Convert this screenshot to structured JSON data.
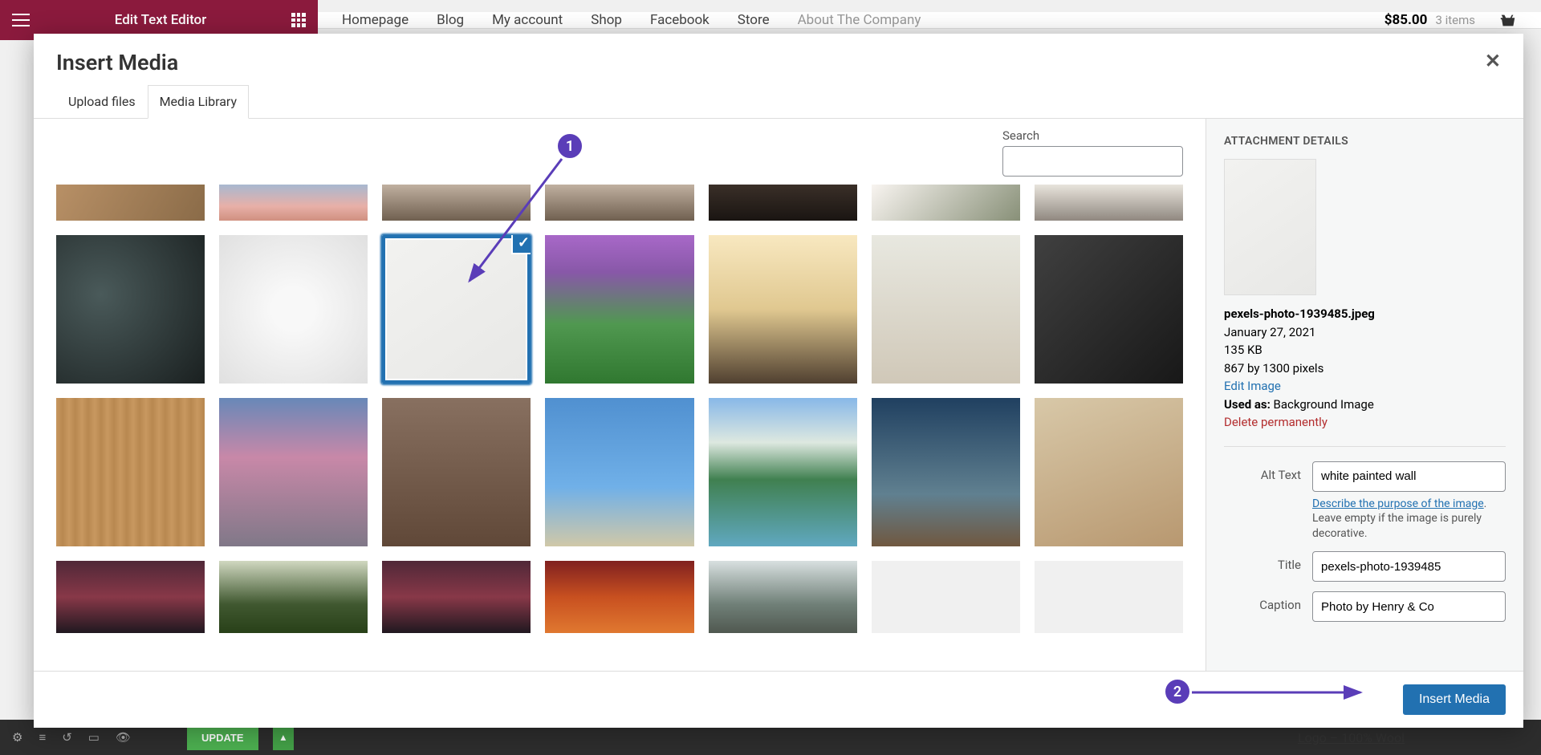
{
  "header": {
    "edit_label": "Edit Text Editor",
    "nav": [
      "Homepage",
      "Blog",
      "My account",
      "Shop",
      "Facebook",
      "Store",
      "About The Company"
    ],
    "cart_price": "$85.00",
    "cart_count": "3 items"
  },
  "bottom": {
    "update_label": "UPDATE",
    "logo_text": "Logo – 100% Wool"
  },
  "modal": {
    "title": "Insert Media",
    "tabs": {
      "upload": "Upload files",
      "library": "Media Library"
    },
    "search_label": "Search",
    "footer_button": "Insert Media"
  },
  "sidebar": {
    "title": "ATTACHMENT DETAILS",
    "filename": "pexels-photo-1939485.jpeg",
    "date": "January 27, 2021",
    "filesize": "135 KB",
    "dimensions": "867 by 1300 pixels",
    "edit_image": "Edit Image",
    "used_as_label": "Used as:",
    "used_as_value": " Background Image",
    "delete": "Delete permanently",
    "alt_label": "Alt Text",
    "alt_value": "white painted wall",
    "alt_help_link": "Describe the purpose of the image",
    "alt_help_rest": ". Leave empty if the image is purely decorative.",
    "title_label": "Title",
    "title_value": "pexels-photo-1939485",
    "caption_label": "Caption",
    "caption_value": "Photo by Henry & Co"
  },
  "annotations": {
    "one": "1",
    "two": "2"
  }
}
